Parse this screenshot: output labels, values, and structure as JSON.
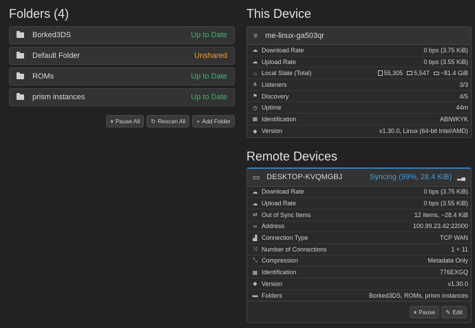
{
  "folders_section": {
    "title": "Folders (4)",
    "items": [
      {
        "name": "Borked3DS",
        "status": "Up to Date",
        "status_color": "#3cb870"
      },
      {
        "name": "Default Folder",
        "status": "Unshared",
        "status_color": "#f0a030"
      },
      {
        "name": "ROMs",
        "status": "Up to Date",
        "status_color": "#3cb870"
      },
      {
        "name": "prism instances",
        "status": "Up to Date",
        "status_color": "#3cb870"
      }
    ],
    "buttons": {
      "pause_all": "Pause All",
      "rescan_all": "Rescan All",
      "add_folder": "Add Folder"
    }
  },
  "this_device": {
    "title": "This Device",
    "name": "me-linux-ga503qr",
    "rows": [
      {
        "icon": "cloud-download-icon",
        "label": "Download Rate",
        "value": "0 bps (3.75 KiB)"
      },
      {
        "icon": "cloud-upload-icon",
        "label": "Upload Rate",
        "value": "0 bps (3.55 KiB)"
      },
      {
        "icon": "home-icon",
        "label": "Local State (Total)",
        "files": "55,305",
        "dirs": "5,547",
        "size": "~81.4 GiB"
      },
      {
        "icon": "sitemap-icon",
        "label": "Listeners",
        "value": "3/3"
      },
      {
        "icon": "signpost-icon",
        "label": "Discovery",
        "value": "4/5"
      },
      {
        "icon": "clock-icon",
        "label": "Uptime",
        "value": "44m"
      },
      {
        "icon": "qrcode-icon",
        "label": "Identification",
        "value": "ABIWKYK"
      },
      {
        "icon": "tag-icon",
        "label": "Version",
        "value": "v1.30.0, Linux (64-bit Intel/AMD)"
      }
    ]
  },
  "remote_devices": {
    "title": "Remote Devices",
    "device": {
      "name": "DESKTOP-KVQMGBJ",
      "status": "Syncing (99%, 28.4 KiB)",
      "rows": [
        {
          "icon": "cloud-download-icon",
          "label": "Download Rate",
          "value": "0 bps (3.75 KiB)"
        },
        {
          "icon": "cloud-upload-icon",
          "label": "Upload Rate",
          "value": "0 bps (3.55 KiB)"
        },
        {
          "icon": "exchange-icon",
          "label": "Out of Sync Items",
          "value": "12 items, ~28.4 KiB"
        },
        {
          "icon": "link-icon",
          "label": "Address",
          "value": "100.99.23.42:22000"
        },
        {
          "icon": "signal-icon",
          "label": "Connection Type",
          "value": "TCP WAN"
        },
        {
          "icon": "random-icon",
          "label": "Number of Connections",
          "value": "1 + 11"
        },
        {
          "icon": "compress-icon",
          "label": "Compression",
          "value": "Metadata Only"
        },
        {
          "icon": "qrcode-icon",
          "label": "Identification",
          "value": "776EXGQ"
        },
        {
          "icon": "tag-icon",
          "label": "Version",
          "value": "v1.30.0"
        },
        {
          "icon": "folder-icon",
          "label": "Folders",
          "value": "Borked3DS, ROMs, prism instances"
        }
      ],
      "buttons": {
        "pause": "Pause",
        "edit": "Edit"
      }
    }
  },
  "colors": {
    "accent_blue": "#3d9de0",
    "ok_green": "#3cb870",
    "warn_orange": "#f0a030",
    "background": "#222222"
  }
}
